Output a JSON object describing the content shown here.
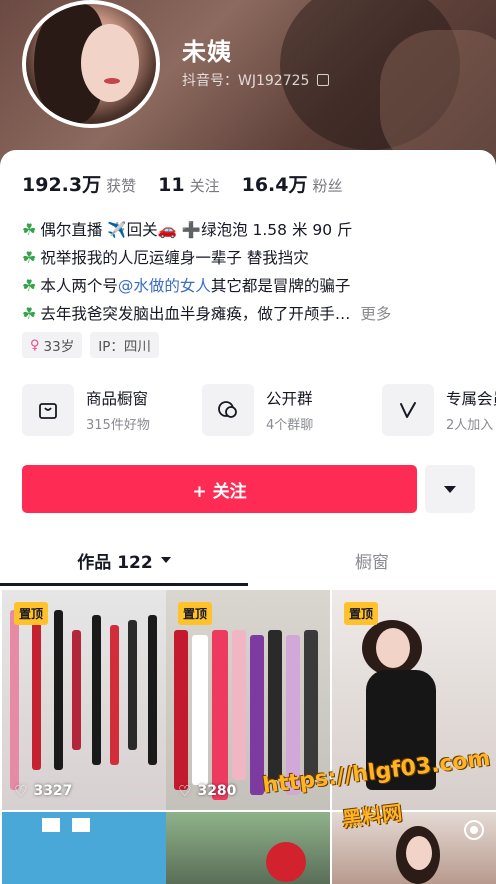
{
  "profile": {
    "name": "未姨",
    "douyin_id": "抖音号：WJ192725"
  },
  "stats": [
    {
      "num": "192.3万",
      "label": "获赞"
    },
    {
      "num": "11",
      "label": "关注"
    },
    {
      "num": "16.4万",
      "label": "粉丝"
    }
  ],
  "bio": {
    "line1": "偶尔直播 ✈️回关🚗 ➕绿泡泡 1.58 米 90 斤",
    "line2": "祝举报我的人厄运缠身一辈子 替我挡灾",
    "line3_pre": "本人两个号 ",
    "line3_mention": "@水做的女人",
    "line3_post": " 其它都是冒牌的骗子",
    "line4": "去年我爸突发脑出血半身瘫痪，做了开颅手…",
    "more": "更多"
  },
  "tags": {
    "age": "33岁",
    "ip": "IP：四川"
  },
  "services": [
    {
      "title": "商品橱窗",
      "sub": "315件好物",
      "icon": "shopping-bag-icon"
    },
    {
      "title": "公开群",
      "sub": "4个群聊",
      "icon": "chat-bubble-icon"
    },
    {
      "title": "专属会员",
      "sub": "2人加入",
      "icon": "v-badge-icon"
    }
  ],
  "actions": {
    "follow": "+ 关注"
  },
  "tabs": {
    "works": "作品 122",
    "showcase": "橱窗"
  },
  "grid": {
    "pin_label": "置顶",
    "likes": [
      "3327",
      "3280"
    ]
  },
  "watermark": {
    "line1": "https://hlgf03.com",
    "line2": "黑料网"
  },
  "colors": {
    "accent": "#fe2c55",
    "mention": "#3a6cc5",
    "pin": "#ffc22b"
  }
}
